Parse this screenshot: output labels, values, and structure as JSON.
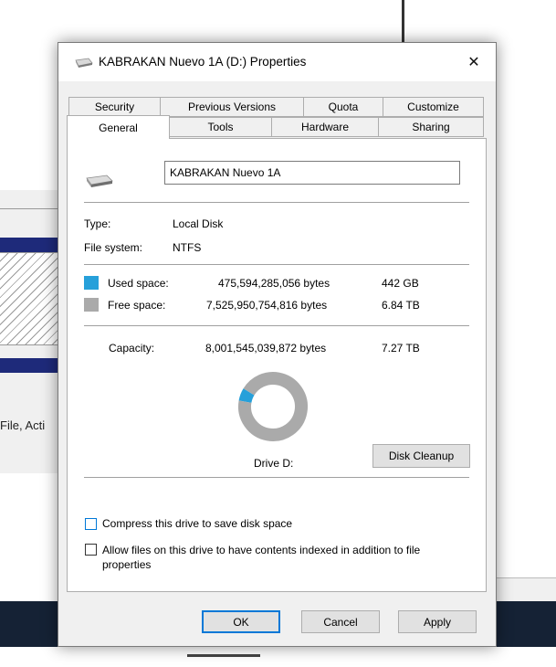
{
  "colors": {
    "used": "#26a0da",
    "free": "#aaaaaa",
    "accent": "#0078d7"
  },
  "background": {
    "partial_text": "File, Acti"
  },
  "dialog": {
    "title": "KABRAKAN Nuevo 1A (D:) Properties",
    "icon": "drive-icon",
    "close_icon": "close-icon",
    "close_glyph": "✕",
    "tabs_row1": [
      "Security",
      "Previous Versions",
      "Quota",
      "Customize"
    ],
    "tabs_row2": [
      "General",
      "Tools",
      "Hardware",
      "Sharing"
    ],
    "active_tab": "General"
  },
  "general": {
    "drive_name": "KABRAKAN Nuevo 1A",
    "type_label": "Type:",
    "type_value": "Local Disk",
    "fs_label": "File system:",
    "fs_value": "NTFS",
    "used_label": "Used space:",
    "used_bytes": "475,594,285,056 bytes",
    "used_size": "442 GB",
    "free_label": "Free space:",
    "free_bytes": "7,525,950,754,816 bytes",
    "free_size": "6.84 TB",
    "capacity_label": "Capacity:",
    "capacity_bytes": "8,001,545,039,872 bytes",
    "capacity_size": "7.27 TB",
    "drive_label": "Drive D:",
    "cleanup_button": "Disk Cleanup",
    "compress_label": "Compress this drive to save disk space",
    "index_label": "Allow files on this drive to have contents indexed in addition to file properties"
  },
  "chart_data": {
    "type": "pie",
    "donut": true,
    "categories": [
      "Used space",
      "Free space"
    ],
    "values": [
      475594285056,
      7525950754816
    ]
  },
  "buttons": {
    "ok": "OK",
    "cancel": "Cancel",
    "apply": "Apply"
  }
}
